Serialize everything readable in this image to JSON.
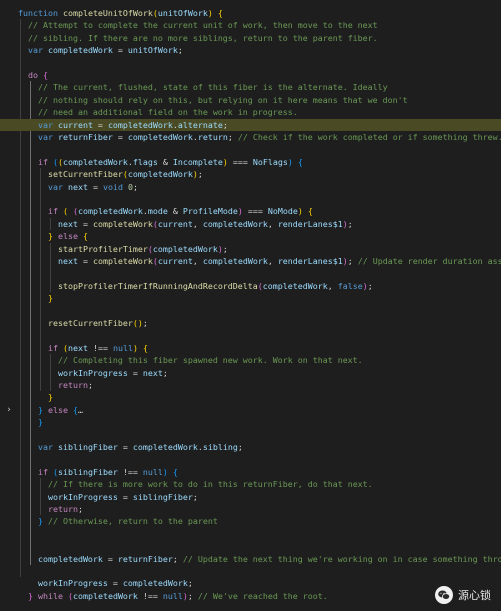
{
  "editor": {
    "lines": [
      {
        "fold": "open",
        "tokens": [
          [
            "kw",
            "function "
          ],
          [
            "fn",
            "completeUnitOfWork"
          ],
          [
            "br1",
            "("
          ],
          [
            "vr",
            "unitOfWork"
          ],
          [
            "br1",
            ")"
          ],
          [
            "pu",
            " "
          ],
          [
            "br1",
            "{"
          ]
        ]
      },
      {
        "tokens": [
          [
            "ws",
            "  "
          ],
          [
            "cm",
            "// Attempt to complete the current unit of work, then move to the next"
          ]
        ]
      },
      {
        "tokens": [
          [
            "ws",
            "  "
          ],
          [
            "cm",
            "// sibling. If there are no more siblings, return to the parent fiber."
          ]
        ]
      },
      {
        "tokens": [
          [
            "ws",
            "  "
          ],
          [
            "kw",
            "var "
          ],
          [
            "vr",
            "completedWork"
          ],
          [
            "pu",
            " = "
          ],
          [
            "vr",
            "unitOfWork"
          ],
          [
            "pu",
            ";"
          ]
        ]
      },
      {
        "tokens": []
      },
      {
        "fold": "open",
        "tokens": [
          [
            "ws",
            "  "
          ],
          [
            "ct",
            "do "
          ],
          [
            "br2",
            "{"
          ]
        ]
      },
      {
        "tokens": [
          [
            "ws",
            "    "
          ],
          [
            "cm",
            "// The current, flushed, state of this fiber is the alternate. Ideally"
          ]
        ]
      },
      {
        "tokens": [
          [
            "ws",
            "    "
          ],
          [
            "cm",
            "// nothing should rely on this, but relying on it here means that we don't"
          ]
        ]
      },
      {
        "tokens": [
          [
            "ws",
            "    "
          ],
          [
            "cm",
            "// need an additional field on the work in progress."
          ]
        ]
      },
      {
        "hl": true,
        "tokens": [
          [
            "ws",
            "    "
          ],
          [
            "kw",
            "var "
          ],
          [
            "vr",
            "current"
          ],
          [
            "pu",
            " = "
          ],
          [
            "vr",
            "completedWork"
          ],
          [
            "pu",
            "."
          ],
          [
            "vr",
            "alternate"
          ],
          [
            "pu",
            ";"
          ]
        ]
      },
      {
        "tokens": [
          [
            "ws",
            "    "
          ],
          [
            "kw",
            "var "
          ],
          [
            "vr",
            "returnFiber"
          ],
          [
            "pu",
            " = "
          ],
          [
            "vr",
            "completedWork"
          ],
          [
            "pu",
            "."
          ],
          [
            "vr",
            "return"
          ],
          [
            "pu",
            "; "
          ],
          [
            "cm",
            "// Check if the work completed or if something threw."
          ]
        ]
      },
      {
        "tokens": []
      },
      {
        "fold": "open",
        "tokens": [
          [
            "ws",
            "    "
          ],
          [
            "ct",
            "if "
          ],
          [
            "br3",
            "("
          ],
          [
            "br1",
            "("
          ],
          [
            "vr",
            "completedWork"
          ],
          [
            "pu",
            "."
          ],
          [
            "vr",
            "flags"
          ],
          [
            "pu",
            " & "
          ],
          [
            "vr",
            "Incomplete"
          ],
          [
            "br1",
            ")"
          ],
          [
            "pu",
            " === "
          ],
          [
            "vr",
            "NoFlags"
          ],
          [
            "br3",
            ")"
          ],
          [
            "pu",
            " "
          ],
          [
            "br3",
            "{"
          ]
        ]
      },
      {
        "tokens": [
          [
            "ws",
            "      "
          ],
          [
            "fn",
            "setCurrentFiber"
          ],
          [
            "br1",
            "("
          ],
          [
            "vr",
            "completedWork"
          ],
          [
            "br1",
            ")"
          ],
          [
            "pu",
            ";"
          ]
        ]
      },
      {
        "tokens": [
          [
            "ws",
            "      "
          ],
          [
            "kw",
            "var "
          ],
          [
            "vr",
            "next"
          ],
          [
            "pu",
            " = "
          ],
          [
            "kw",
            "void "
          ],
          [
            "nm",
            "0"
          ],
          [
            "pu",
            ";"
          ]
        ]
      },
      {
        "tokens": []
      },
      {
        "fold": "open",
        "tokens": [
          [
            "ws",
            "      "
          ],
          [
            "ct",
            "if "
          ],
          [
            "br1",
            "("
          ],
          [
            "pu",
            " "
          ],
          [
            "br2",
            "("
          ],
          [
            "vr",
            "completedWork"
          ],
          [
            "pu",
            "."
          ],
          [
            "vr",
            "mode"
          ],
          [
            "pu",
            " & "
          ],
          [
            "vr",
            "ProfileMode"
          ],
          [
            "br2",
            ")"
          ],
          [
            "pu",
            " === "
          ],
          [
            "vr",
            "NoMode"
          ],
          [
            "br1",
            ")"
          ],
          [
            "pu",
            " "
          ],
          [
            "br1",
            "{"
          ]
        ]
      },
      {
        "tokens": [
          [
            "ws",
            "        "
          ],
          [
            "vr",
            "next"
          ],
          [
            "pu",
            " = "
          ],
          [
            "fn",
            "completeWork"
          ],
          [
            "br2",
            "("
          ],
          [
            "vr",
            "current"
          ],
          [
            "pu",
            ", "
          ],
          [
            "vr",
            "completedWork"
          ],
          [
            "pu",
            ", "
          ],
          [
            "vr",
            "renderLanes$1"
          ],
          [
            "br2",
            ")"
          ],
          [
            "pu",
            ";"
          ]
        ]
      },
      {
        "fold": "open",
        "tokens": [
          [
            "ws",
            "      "
          ],
          [
            "br1",
            "}"
          ],
          [
            "pu",
            " "
          ],
          [
            "ct",
            "else "
          ],
          [
            "br1",
            "{"
          ]
        ]
      },
      {
        "tokens": [
          [
            "ws",
            "        "
          ],
          [
            "fn",
            "startProfilerTimer"
          ],
          [
            "br2",
            "("
          ],
          [
            "vr",
            "completedWork"
          ],
          [
            "br2",
            ")"
          ],
          [
            "pu",
            ";"
          ]
        ]
      },
      {
        "tokens": [
          [
            "ws",
            "        "
          ],
          [
            "vr",
            "next"
          ],
          [
            "pu",
            " = "
          ],
          [
            "fn",
            "completeWork"
          ],
          [
            "br2",
            "("
          ],
          [
            "vr",
            "current"
          ],
          [
            "pu",
            ", "
          ],
          [
            "vr",
            "completedWork"
          ],
          [
            "pu",
            ", "
          ],
          [
            "vr",
            "renderLanes$1"
          ],
          [
            "br2",
            ")"
          ],
          [
            "pu",
            "; "
          ],
          [
            "cm",
            "// Update render duration assuming it didn't error."
          ]
        ]
      },
      {
        "tokens": []
      },
      {
        "tokens": [
          [
            "ws",
            "        "
          ],
          [
            "fn",
            "stopProfilerTimerIfRunningAndRecordDelta"
          ],
          [
            "br2",
            "("
          ],
          [
            "vr",
            "completedWork"
          ],
          [
            "pu",
            ", "
          ],
          [
            "kw",
            "false"
          ],
          [
            "br2",
            ")"
          ],
          [
            "pu",
            ";"
          ]
        ]
      },
      {
        "tokens": [
          [
            "ws",
            "      "
          ],
          [
            "br1",
            "}"
          ]
        ]
      },
      {
        "tokens": []
      },
      {
        "tokens": [
          [
            "ws",
            "      "
          ],
          [
            "fn",
            "resetCurrentFiber"
          ],
          [
            "br1",
            "("
          ],
          [
            "br1",
            ")"
          ],
          [
            "pu",
            ";"
          ]
        ]
      },
      {
        "tokens": []
      },
      {
        "fold": "open",
        "tokens": [
          [
            "ws",
            "      "
          ],
          [
            "ct",
            "if "
          ],
          [
            "br1",
            "("
          ],
          [
            "vr",
            "next"
          ],
          [
            "pu",
            " !== "
          ],
          [
            "kw",
            "null"
          ],
          [
            "br1",
            ")"
          ],
          [
            "pu",
            " "
          ],
          [
            "br1",
            "{"
          ]
        ]
      },
      {
        "tokens": [
          [
            "ws",
            "        "
          ],
          [
            "cm",
            "// Completing this fiber spawned new work. Work on that next."
          ]
        ]
      },
      {
        "tokens": [
          [
            "ws",
            "        "
          ],
          [
            "vr",
            "workInProgress"
          ],
          [
            "pu",
            " = "
          ],
          [
            "vr",
            "next"
          ],
          [
            "pu",
            ";"
          ]
        ]
      },
      {
        "tokens": [
          [
            "ws",
            "        "
          ],
          [
            "ct",
            "return"
          ],
          [
            "pu",
            ";"
          ]
        ]
      },
      {
        "tokens": [
          [
            "ws",
            "      "
          ],
          [
            "br1",
            "}"
          ]
        ]
      },
      {
        "fold": "closed",
        "tokens": [
          [
            "ws",
            "    "
          ],
          [
            "br3",
            "}"
          ],
          [
            "pu",
            " "
          ],
          [
            "ct",
            "else "
          ],
          [
            "br3",
            "{"
          ],
          [
            "pu",
            "…"
          ]
        ]
      },
      {
        "tokens": [
          [
            "ws",
            "    "
          ],
          [
            "br3",
            "}"
          ]
        ]
      },
      {
        "tokens": []
      },
      {
        "tokens": [
          [
            "ws",
            "    "
          ],
          [
            "kw",
            "var "
          ],
          [
            "vr",
            "siblingFiber"
          ],
          [
            "pu",
            " = "
          ],
          [
            "vr",
            "completedWork"
          ],
          [
            "pu",
            "."
          ],
          [
            "vr",
            "sibling"
          ],
          [
            "pu",
            ";"
          ]
        ]
      },
      {
        "tokens": []
      },
      {
        "fold": "open",
        "tokens": [
          [
            "ws",
            "    "
          ],
          [
            "ct",
            "if "
          ],
          [
            "br3",
            "("
          ],
          [
            "vr",
            "siblingFiber"
          ],
          [
            "pu",
            " !== "
          ],
          [
            "kw",
            "null"
          ],
          [
            "br3",
            ")"
          ],
          [
            "pu",
            " "
          ],
          [
            "br3",
            "{"
          ]
        ]
      },
      {
        "tokens": [
          [
            "ws",
            "      "
          ],
          [
            "cm",
            "// If there is more work to do in this returnFiber, do that next."
          ]
        ]
      },
      {
        "tokens": [
          [
            "ws",
            "      "
          ],
          [
            "vr",
            "workInProgress"
          ],
          [
            "pu",
            " = "
          ],
          [
            "vr",
            "siblingFiber"
          ],
          [
            "pu",
            ";"
          ]
        ]
      },
      {
        "tokens": [
          [
            "ws",
            "      "
          ],
          [
            "ct",
            "return"
          ],
          [
            "pu",
            ";"
          ]
        ]
      },
      {
        "tokens": [
          [
            "ws",
            "    "
          ],
          [
            "br3",
            "}"
          ],
          [
            "pu",
            " "
          ],
          [
            "cm",
            "// Otherwise, return to the parent"
          ]
        ]
      },
      {
        "tokens": []
      },
      {
        "tokens": []
      },
      {
        "tokens": [
          [
            "ws",
            "    "
          ],
          [
            "vr",
            "completedWork"
          ],
          [
            "pu",
            " = "
          ],
          [
            "vr",
            "returnFiber"
          ],
          [
            "pu",
            "; "
          ],
          [
            "cm",
            "// Update the next thing we're working on in case something throws."
          ]
        ]
      },
      {
        "tokens": []
      },
      {
        "tokens": [
          [
            "ws",
            "    "
          ],
          [
            "vr",
            "workInProgress"
          ],
          [
            "pu",
            " = "
          ],
          [
            "vr",
            "completedWork"
          ],
          [
            "pu",
            ";"
          ]
        ]
      },
      {
        "tokens": [
          [
            "ws",
            "  "
          ],
          [
            "br2",
            "}"
          ],
          [
            "pu",
            " "
          ],
          [
            "ct",
            "while "
          ],
          [
            "br2",
            "("
          ],
          [
            "vr",
            "completedWork"
          ],
          [
            "pu",
            " !== "
          ],
          [
            "kw",
            "null"
          ],
          [
            "br2",
            ")"
          ],
          [
            "pu",
            "; "
          ],
          [
            "cm",
            "// We've reached the root."
          ]
        ]
      }
    ]
  },
  "watermark": {
    "icon": "wechat-icon",
    "label": "源心锁"
  },
  "colors": {
    "background": "#1e1e1e",
    "highlight_line": "#4a4a24"
  }
}
